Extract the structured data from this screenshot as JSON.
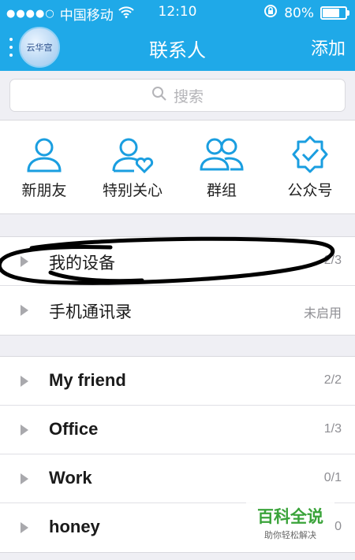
{
  "status_bar": {
    "carrier": "中国移动",
    "time": "12:10",
    "battery": "80%",
    "battery_level": 0.8
  },
  "nav": {
    "title": "联系人",
    "add_label": "添加",
    "avatar_text": "云华宫"
  },
  "search": {
    "placeholder": "搜索"
  },
  "quick_actions": [
    {
      "label": "新朋友",
      "icon": "new-friend-icon"
    },
    {
      "label": "特别关心",
      "icon": "special-care-icon"
    },
    {
      "label": "群组",
      "icon": "group-icon"
    },
    {
      "label": "公众号",
      "icon": "official-account-icon"
    }
  ],
  "system_groups": [
    {
      "name": "我的设备",
      "count": "2/3"
    },
    {
      "name": "手机通讯录",
      "count": "未启用"
    }
  ],
  "friend_groups": [
    {
      "name": "My friend",
      "count": "2/2"
    },
    {
      "name": "Office",
      "count": "1/3"
    },
    {
      "name": "Work",
      "count": "0/1"
    },
    {
      "name": "honey",
      "count": "0"
    }
  ],
  "watermark": {
    "main": "百科全说",
    "sub": "助你轻松解决"
  },
  "colors": {
    "accent": "#1fa9e8",
    "icon_blue": "#1a9ee0"
  }
}
